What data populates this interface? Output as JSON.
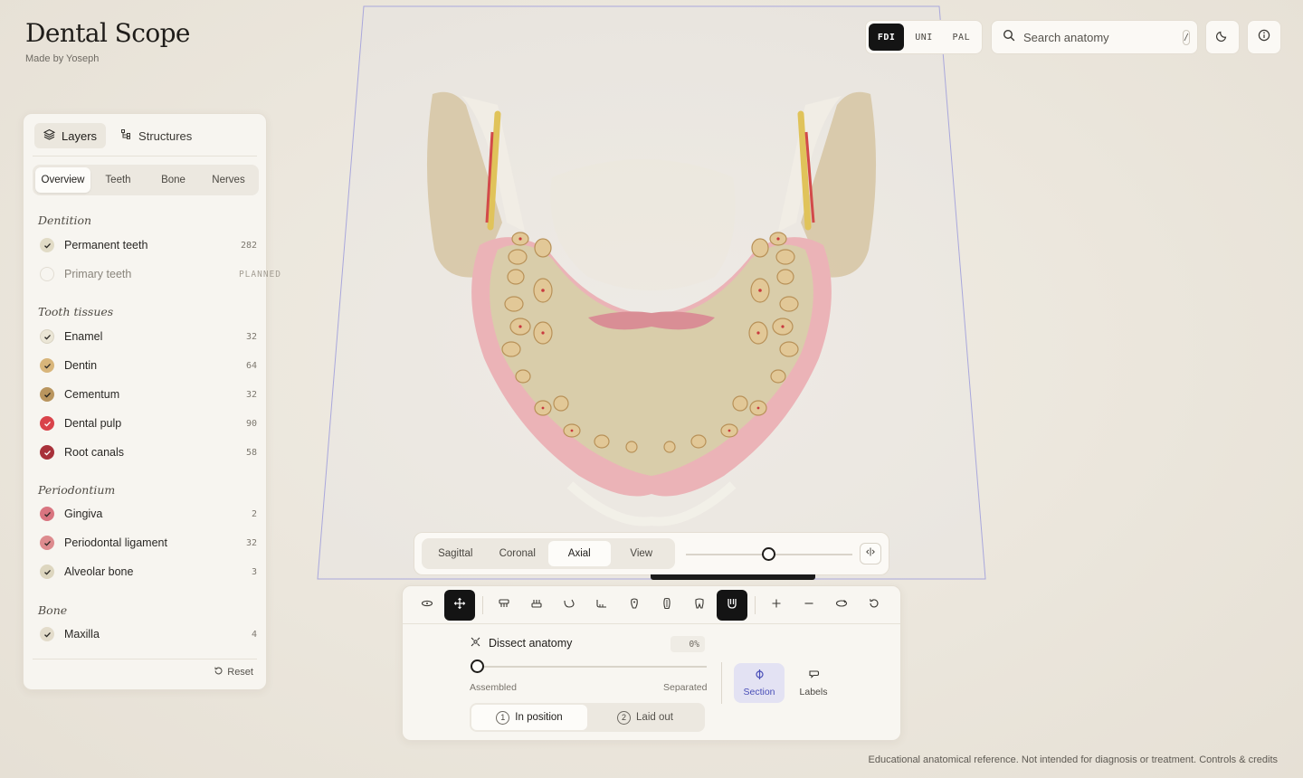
{
  "brand": {
    "title": "Dental Scope",
    "subtitle": "Made by Yoseph"
  },
  "numbering": {
    "options": [
      "FDI",
      "UNI",
      "PAL"
    ],
    "selected": "FDI"
  },
  "search": {
    "placeholder": "Search anatomy",
    "shortcut": "/"
  },
  "top_buttons": [
    "moon-icon",
    "info-icon"
  ],
  "panel": {
    "tabs": [
      "Layers",
      "Structures"
    ],
    "active_tab": "Layers",
    "segments": [
      "Overview",
      "Teeth",
      "Bone",
      "Nerves"
    ],
    "active_segment": "Overview",
    "groups": [
      {
        "title": "Dentition",
        "items": [
          {
            "label": "Permanent teeth",
            "count": "282",
            "checked": true,
            "color": "#d9d3be"
          },
          {
            "label": "Primary teeth",
            "count": "PLANNED",
            "checked": false,
            "color": "#e8e3d9"
          }
        ]
      },
      {
        "title": "Tooth tissues",
        "items": [
          {
            "label": "Enamel",
            "count": "32",
            "checked": true,
            "color": "#e9e4d3"
          },
          {
            "label": "Dentin",
            "count": "64",
            "checked": true,
            "color": "#d8b57a"
          },
          {
            "label": "Cementum",
            "count": "32",
            "checked": true,
            "color": "#b9955e"
          },
          {
            "label": "Dental pulp",
            "count": "90",
            "checked": true,
            "color": "#d9434a"
          },
          {
            "label": "Root canals",
            "count": "58",
            "checked": true,
            "color": "#a8313a"
          }
        ]
      },
      {
        "title": "Periodontium",
        "items": [
          {
            "label": "Gingiva",
            "count": "2",
            "checked": true,
            "color": "#d97580"
          },
          {
            "label": "Periodontal ligament",
            "count": "32",
            "checked": true,
            "color": "#dd8b8e"
          },
          {
            "label": "Alveolar bone",
            "count": "3",
            "checked": true,
            "color": "#ddd6bf"
          }
        ]
      },
      {
        "title": "Bone",
        "items": [
          {
            "label": "Maxilla",
            "count": "4",
            "checked": true,
            "color": "#e3dccb"
          }
        ]
      }
    ],
    "reset_label": "Reset"
  },
  "planes": {
    "options": [
      "Sagittal",
      "Coronal",
      "Axial",
      "View"
    ],
    "selected": "Axial",
    "slider_fraction": 0.5
  },
  "toolbar": {
    "icons": [
      "rotate-icon",
      "pan-icon",
      "upper-jaw-icon",
      "lower-jaw-icon",
      "jaw-side-icon",
      "jaw-profile-icon",
      "tooth-front-icon",
      "tooth-side-icon",
      "molar-icon",
      "arch-icon",
      "zoom-in-icon",
      "zoom-out-icon",
      "orbit-icon",
      "reset-view-icon"
    ],
    "active": [
      "pan-icon",
      "arch-icon"
    ]
  },
  "dissect": {
    "title": "Dissect anatomy",
    "percent": "0%",
    "value": 0,
    "left_label": "Assembled",
    "right_label": "Separated",
    "modes": [
      {
        "num": "1",
        "label": "In position"
      },
      {
        "num": "2",
        "label": "Laid out"
      }
    ],
    "active_mode": "In position"
  },
  "side_buttons": [
    {
      "label": "Section",
      "active": true
    },
    {
      "label": "Labels",
      "active": false
    }
  ],
  "footer": {
    "text": "Educational anatomical reference. Not intended for diagnosis or treatment.",
    "link": "Controls & credits"
  },
  "colors": {
    "accent": "#141414",
    "section_active_bg": "#e3e2f3",
    "section_active_fg": "#4a4fb8",
    "gingiva": "#e8a4ab",
    "bone": "#d9cdaa",
    "nerve": "#e0c35a"
  }
}
